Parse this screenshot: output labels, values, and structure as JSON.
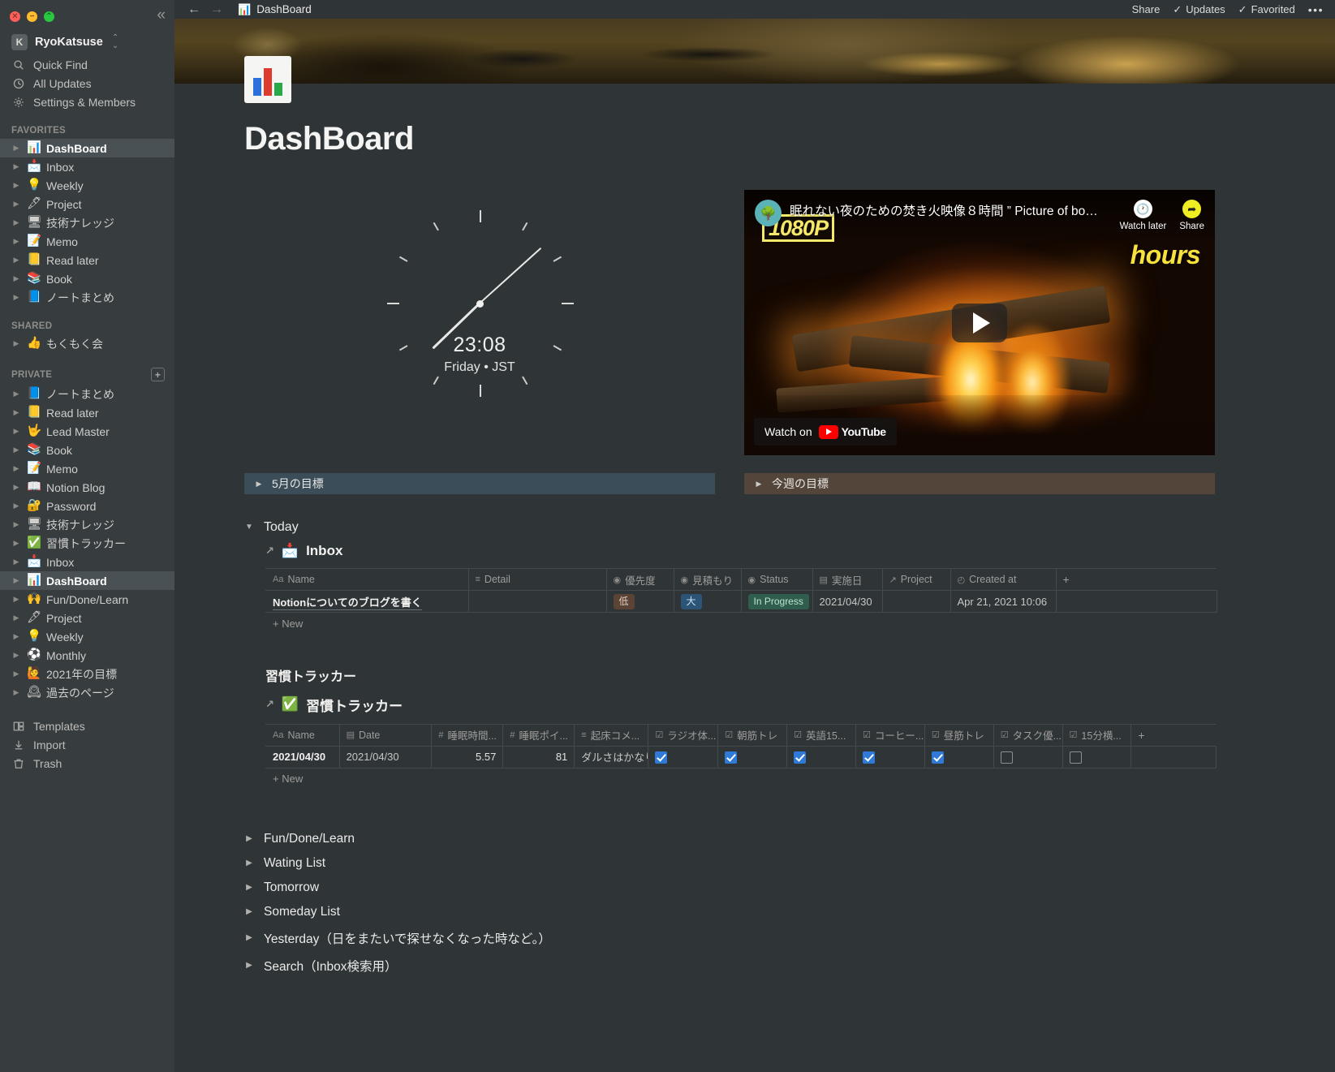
{
  "window": {
    "traffic_lights": [
      "close",
      "minimize",
      "maximize"
    ],
    "collapse_label": "«"
  },
  "sidebar": {
    "workspace": {
      "initial": "K",
      "name": "RyoKatsuse",
      "chevron": "⌄"
    },
    "nav": [
      {
        "label": "Quick Find",
        "icon": "search-icon"
      },
      {
        "label": "All Updates",
        "icon": "clock-icon"
      },
      {
        "label": "Settings & Members",
        "icon": "gear-icon"
      }
    ],
    "favorites_label": "FAVORITES",
    "favorites": [
      {
        "emoji": "📊",
        "label": "DashBoard",
        "active": true
      },
      {
        "emoji": "📩",
        "label": "Inbox"
      },
      {
        "emoji": "💡",
        "label": "Weekly"
      },
      {
        "emoji": "🖋",
        "label": "Project"
      },
      {
        "emoji": "🖥",
        "label": "技術ナレッジ"
      },
      {
        "emoji": "📝",
        "label": "Memo"
      },
      {
        "emoji": "📒",
        "label": "Read later"
      },
      {
        "emoji": "📚",
        "label": "Book"
      },
      {
        "emoji": "📘",
        "label": "ノートまとめ"
      }
    ],
    "shared_label": "SHARED",
    "shared": [
      {
        "emoji": "👍",
        "label": "もくもく会"
      }
    ],
    "private_label": "PRIVATE",
    "private_add": "+",
    "private": [
      {
        "emoji": "📘",
        "label": "ノートまとめ"
      },
      {
        "emoji": "📒",
        "label": "Read later"
      },
      {
        "emoji": "🤟",
        "label": "Lead Master"
      },
      {
        "emoji": "📚",
        "label": "Book"
      },
      {
        "emoji": "📝",
        "label": "Memo"
      },
      {
        "emoji": "📖",
        "label": "Notion Blog"
      },
      {
        "emoji": "🔐",
        "label": "Password"
      },
      {
        "emoji": "🖥",
        "label": "技術ナレッジ"
      },
      {
        "emoji": "✅",
        "label": "習慣トラッカー"
      },
      {
        "emoji": "📩",
        "label": "Inbox"
      },
      {
        "emoji": "📊",
        "label": "DashBoard",
        "active": true
      },
      {
        "emoji": "🙌",
        "label": "Fun/Done/Learn"
      },
      {
        "emoji": "🖋",
        "label": "Project"
      },
      {
        "emoji": "💡",
        "label": "Weekly"
      },
      {
        "emoji": "⚽",
        "label": "Monthly"
      },
      {
        "emoji": "🙋",
        "label": "2021年の目標"
      },
      {
        "emoji": "🕰",
        "label": "過去のページ"
      }
    ],
    "bottom": [
      {
        "label": "Templates",
        "icon": "templates-icon"
      },
      {
        "label": "Import",
        "icon": "import-icon"
      },
      {
        "label": "Trash",
        "icon": "trash-icon"
      }
    ]
  },
  "topbar": {
    "back": "←",
    "forward": "→",
    "breadcrumb": "DashBoard",
    "breadcrumb_emoji": "📊",
    "share": "Share",
    "updates": "Updates",
    "favorited": "Favorited",
    "more": "•••"
  },
  "page": {
    "title": "DashBoard"
  },
  "clock": {
    "time": "23:08",
    "subtitle": "Friday • JST",
    "hour_deg": 226,
    "minute_deg": 48
  },
  "video": {
    "title": "眠れない夜のための焚き火映像８時間 ” Picture of bo…",
    "watch_later": "Watch later",
    "share": "Share",
    "badge": "1080P",
    "overlay_text": "hours",
    "watch_on": "Watch on",
    "youtube": "YouTube"
  },
  "banners": [
    {
      "label": "5月の目標",
      "color": "blue"
    },
    {
      "label": "今週の目標",
      "color": "brown"
    }
  ],
  "today": {
    "label": "Today",
    "database": {
      "title": "Inbox",
      "emoji": "📩",
      "columns": [
        {
          "label": "Name",
          "icon": "text-icon"
        },
        {
          "label": "Detail",
          "icon": "lines-icon"
        },
        {
          "label": "優先度",
          "icon": "select-icon"
        },
        {
          "label": "見積もり",
          "icon": "select-icon"
        },
        {
          "label": "Status",
          "icon": "select-icon"
        },
        {
          "label": "実施日",
          "icon": "date-icon"
        },
        {
          "label": "Project",
          "icon": "relation-icon"
        },
        {
          "label": "Created at",
          "icon": "created-icon"
        },
        {
          "label": "+",
          "icon": "plus-icon"
        }
      ],
      "rows": [
        {
          "name": "Notionについてのブログを書く",
          "detail": "",
          "priority": "低",
          "estimate": "大",
          "status": "In Progress",
          "date": "2021/04/30",
          "project": "",
          "created": "Apr 21, 2021 10:06"
        }
      ],
      "add_label": "New"
    }
  },
  "habit": {
    "section_title": "習慣トラッカー",
    "database": {
      "title": "習慣トラッカー",
      "emoji": "✅",
      "columns": [
        {
          "label": "Name",
          "icon": "text-icon"
        },
        {
          "label": "Date",
          "icon": "date-icon"
        },
        {
          "label": "睡眠時間...",
          "icon": "number-icon"
        },
        {
          "label": "睡眠ポイ...",
          "icon": "number-icon"
        },
        {
          "label": "起床コメ...",
          "icon": "lines-icon"
        },
        {
          "label": "ラジオ体...",
          "icon": "checkbox-icon"
        },
        {
          "label": "朝筋トレ",
          "icon": "checkbox-icon"
        },
        {
          "label": "英語15...",
          "icon": "checkbox-icon"
        },
        {
          "label": "コーヒー...",
          "icon": "checkbox-icon"
        },
        {
          "label": "昼筋トレ",
          "icon": "checkbox-icon"
        },
        {
          "label": "タスク優...",
          "icon": "checkbox-icon"
        },
        {
          "label": "15分横...",
          "icon": "checkbox-icon"
        },
        {
          "label": "+",
          "icon": "plus-icon"
        }
      ],
      "rows": [
        {
          "name": "2021/04/30",
          "date": "2021/04/30",
          "sleep_hours": "5.57",
          "sleep_points": "81",
          "comment": "ダルさはかなり…",
          "checks": [
            true,
            true,
            true,
            true,
            true,
            false,
            false
          ]
        }
      ],
      "add_label": "New"
    }
  },
  "bottom_toggles": [
    {
      "label": "Fun/Done/Learn"
    },
    {
      "label": "Wating List"
    },
    {
      "label": "Tomorrow"
    },
    {
      "label": "Someday List"
    },
    {
      "label": "Yesterday（日をまたいで探せなくなった時など。）"
    },
    {
      "label": "Search（Inbox検索用）"
    }
  ],
  "colors": {
    "sidebar_bg": "#373c3f",
    "main_bg": "#2f3437",
    "accent_blue": "#2e7ad6",
    "banner_blue": "#3b4d59",
    "banner_brown": "#54453a"
  }
}
